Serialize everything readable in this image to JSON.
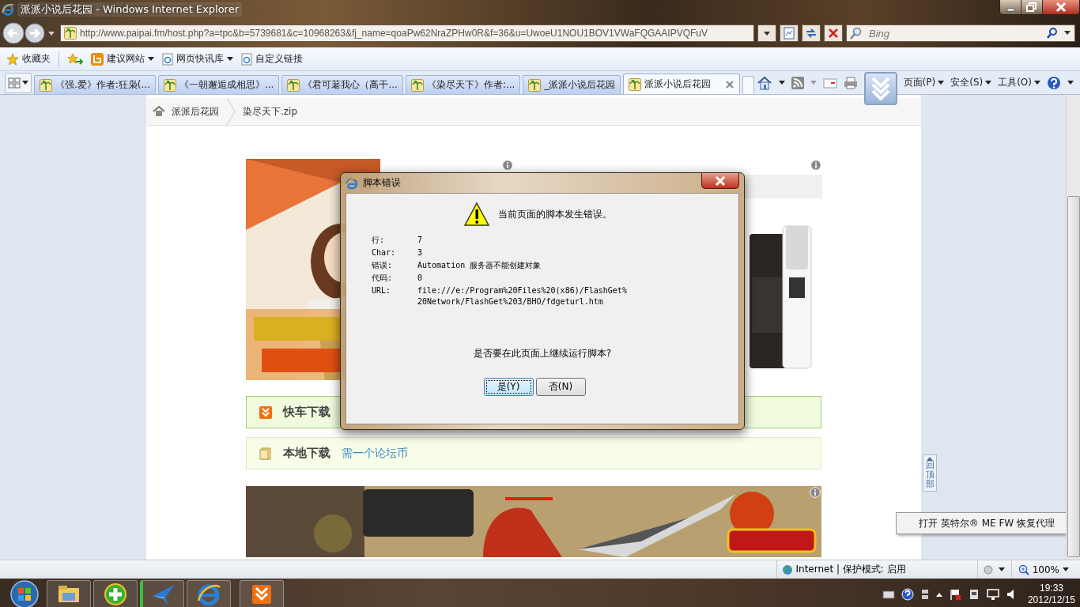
{
  "window": {
    "title": "派派小说后花园 - Windows Internet Explorer"
  },
  "address_bar": {
    "url": "http://www.paipai.fm/host.php?a=tpc&b=5739681&c=10968263&fj_name=qoaPw62NraZPHw0R&f=36&u=UwoeU1NOU1BOV1VWaFQGAAIPVQFuV"
  },
  "search": {
    "placeholder": "Bing"
  },
  "favorites_bar": {
    "title": "收藏夹",
    "items": [
      {
        "label": "建议网站",
        "kind": "suggested",
        "has_menu": true
      },
      {
        "label": "网页快讯库",
        "kind": "ie",
        "has_menu": true
      },
      {
        "label": "自定义链接",
        "kind": "ie",
        "has_menu": false
      }
    ]
  },
  "tabs": [
    {
      "label": "《强.爱》作者:狂枭(...",
      "selected": false
    },
    {
      "label": "《一朝邂逅成相思》...",
      "selected": false
    },
    {
      "label": "《君可荖我心（高干...",
      "selected": false
    },
    {
      "label": "《染尽天下》作者:...",
      "selected": false
    },
    {
      "label": "_派派小说后花园",
      "selected": false
    },
    {
      "label": "派派小说后花园",
      "selected": true
    }
  ],
  "command_bar": [
    "页面(P)",
    "安全(S)",
    "工具(O)"
  ],
  "breadcrumb": [
    "派派后花园",
    "染尽天下.zip"
  ],
  "downloads": [
    {
      "kind": "express",
      "title": "快车下载"
    },
    {
      "kind": "local",
      "title": "本地下载",
      "link": "需一个论坛币"
    }
  ],
  "back_to_top": "回顶部",
  "popup": "打开 英特尔® ME FW 恢复代理",
  "dialog": {
    "title": "脚本错误",
    "message": "当前页面的脚本发生错误。",
    "fields": [
      {
        "label": "行:",
        "value": "7"
      },
      {
        "label": "Char:",
        "value": "3"
      },
      {
        "label": "错误:",
        "value": "Automation 服务器不能创建对象"
      },
      {
        "label": "代码:",
        "value": "0"
      },
      {
        "label": "URL:",
        "value": "file:///e:/Program%20Files%20(x86)/FlashGet%20Network/FlashGet%203/BHO/fdgeturl.htm"
      }
    ],
    "question": "是否要在此页面上继续运行脚本?",
    "buttons": [
      {
        "label": "是(Y)",
        "selected": true
      },
      {
        "label": "否(N)",
        "selected": false
      }
    ]
  },
  "status_bar": {
    "zone": "Internet | 保护模式: 启用",
    "zoom": "100%"
  },
  "taskbar": {
    "time": "19:33",
    "date": "2012/12/15"
  }
}
